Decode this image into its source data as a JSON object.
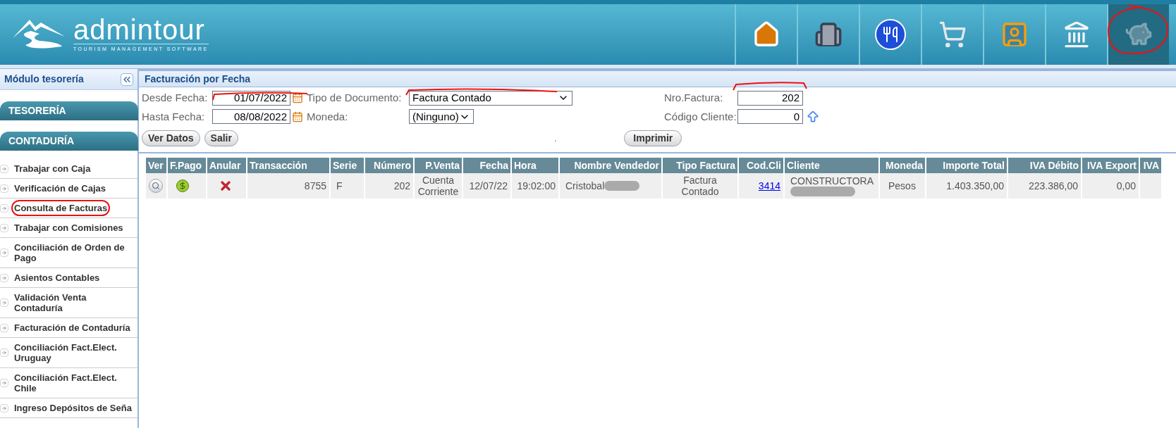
{
  "header": {
    "logo": {
      "name": "admintour",
      "tagline": "TOURISM MANAGEMENT SOFTWARE"
    },
    "nav": [
      {
        "kind": "home",
        "selected": false
      },
      {
        "kind": "building",
        "selected": false
      },
      {
        "kind": "restaurant",
        "selected": false
      },
      {
        "kind": "cart",
        "selected": false
      },
      {
        "kind": "person",
        "selected": false
      },
      {
        "kind": "bank",
        "selected": false
      },
      {
        "kind": "piggy",
        "selected": true
      }
    ]
  },
  "sidebar": {
    "title": "Módulo tesorería",
    "sections": [
      {
        "label": "TESORERÍA"
      },
      {
        "label": "CONTADURÍA",
        "items": [
          {
            "label": "Trabajar con Caja",
            "circled": false
          },
          {
            "label": "Verificación de Cajas",
            "circled": false
          },
          {
            "label": "Consulta de Facturas",
            "circled": true
          },
          {
            "label": "Trabajar con Comisiones",
            "circled": false
          },
          {
            "label": "Conciliación de Orden de Pago",
            "circled": false
          },
          {
            "label": "Asientos Contables",
            "circled": false
          },
          {
            "label": "Validación Venta Contaduría",
            "circled": false
          },
          {
            "label": "Facturación de Contaduría",
            "circled": false
          },
          {
            "label": "Conciliación Fact.Elect. Uruguay",
            "circled": false
          },
          {
            "label": "Conciliación Fact.Elect. Chile",
            "circled": false
          },
          {
            "label": "Ingreso Depósitos de Seña",
            "circled": false
          }
        ]
      }
    ]
  },
  "panel": {
    "title": "Facturación por Fecha",
    "desde": {
      "label": "Desde Fecha:",
      "value": "01/07/2022"
    },
    "hasta": {
      "label": "Hasta Fecha:",
      "value": "08/08/2022"
    },
    "tipo": {
      "label": "Tipo de Documento:",
      "value": "Factura Contado"
    },
    "moneda": {
      "label": "Moneda:",
      "value": "(Ninguno)"
    },
    "nro": {
      "label": "Nro.Factura:",
      "value": "202"
    },
    "cliente": {
      "label": "Código Cliente:",
      "value": "0"
    },
    "buttons": [
      "Ver Datos",
      "Salir"
    ],
    "dot": ".",
    "print": "Imprimir"
  },
  "table": {
    "columns": [
      "Ver",
      "F.Pago",
      "Anular",
      "Transacción",
      "Serie",
      "Número",
      "P.Venta",
      "Fecha",
      "Hora",
      "Nombre Vendedor",
      "Tipo Factura",
      "Cod.Cli",
      "Cliente",
      "Moneda",
      "Importe Total",
      "IVA Débito",
      "IVA Export",
      "IVA"
    ],
    "rows": [
      {
        "transaccion": "8755",
        "serie": "F",
        "numero": "202",
        "pventa": "Cuenta Corriente",
        "fecha": "12/07/22",
        "hora": "19:02:00",
        "vendedor": "Cristobal",
        "tipo": "Factura Contado",
        "codcli": "3414",
        "cliente": "CONSTRUCTORA",
        "moneda": "Pesos",
        "importe": "1.403.350,00",
        "iva_debito": "223.386,00",
        "iva_export": "0,00"
      }
    ]
  }
}
